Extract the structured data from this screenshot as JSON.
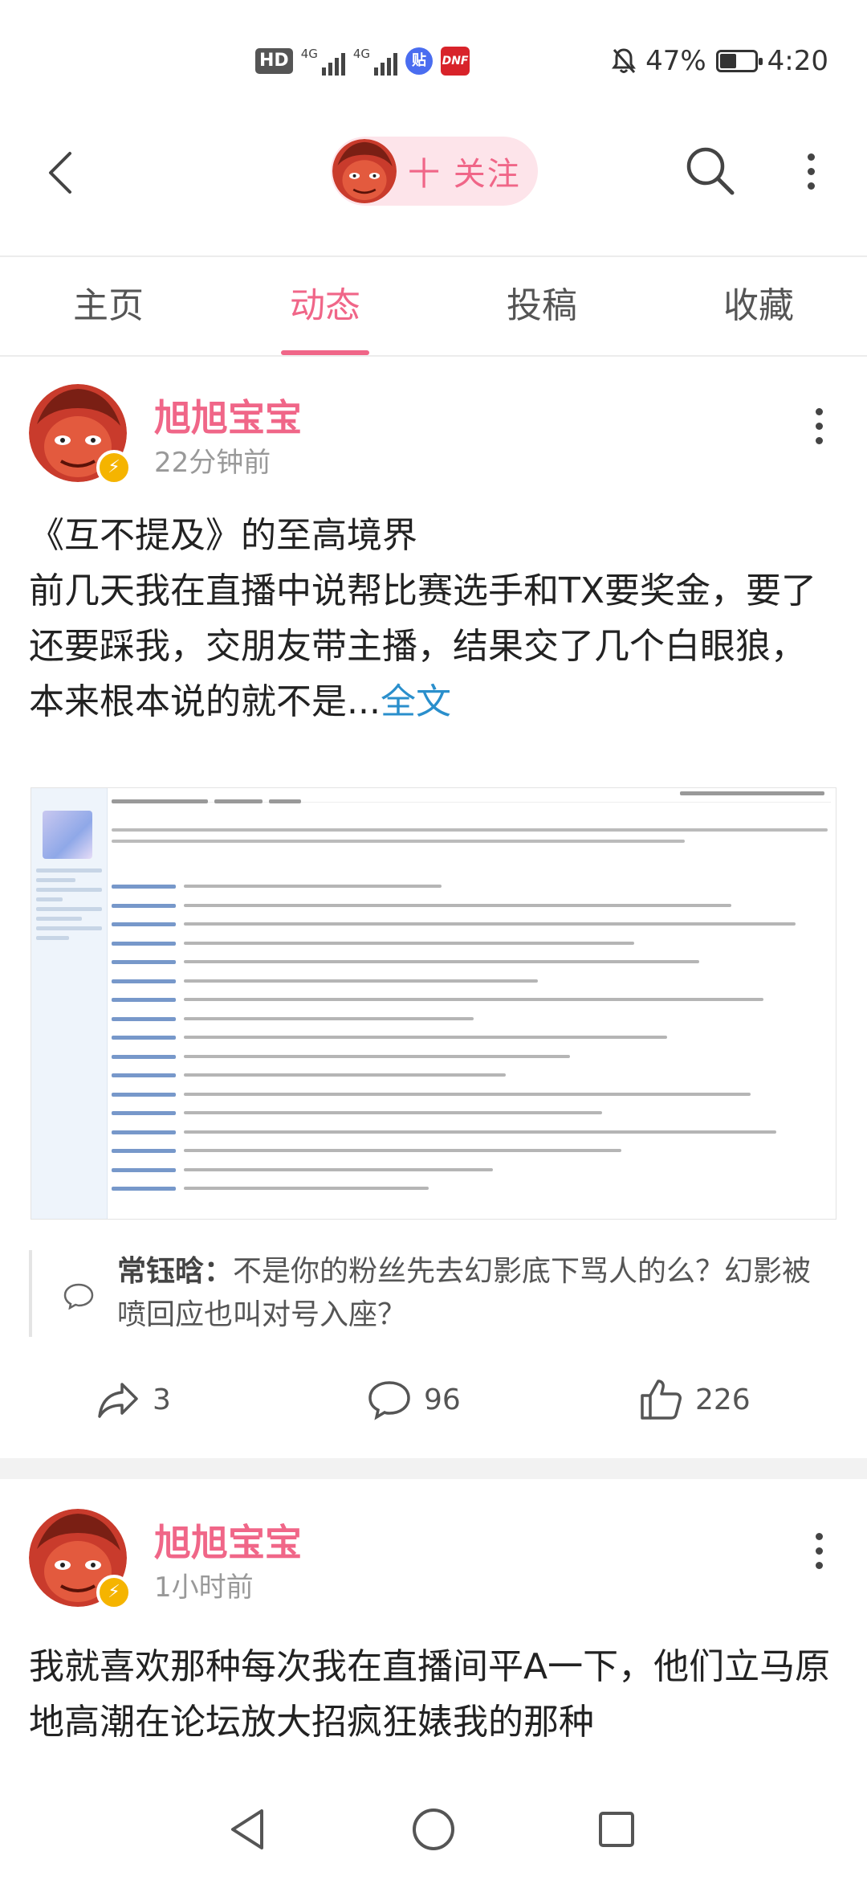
{
  "status_bar": {
    "hd_label": "HD",
    "net1": "4G",
    "net2": "4G",
    "app1_label": "贴",
    "app2_label": "DNF",
    "battery": "47%",
    "battery_fraction": 0.47,
    "time": "4:20"
  },
  "header": {
    "follow_label": "十 关注"
  },
  "tabs": [
    {
      "label": "主页"
    },
    {
      "label": "动态",
      "active": true
    },
    {
      "label": "投稿"
    },
    {
      "label": "收藏"
    }
  ],
  "posts": [
    {
      "author": "旭旭宝宝",
      "time": "22分钟前",
      "text_line1": "《互不提及》的至高境界",
      "text_body": "前几天我在直播中说帮比赛选手和TX要奖金，要了还要踩我，交朋友带主播，结果交了几个白眼狼，本来根本说的就不是...",
      "full_text_link": "全文",
      "comment_author": "常钰晗：",
      "comment_text": "不是你的粉丝先去幻影底下骂人的么？幻影被喷回应也叫对号入座？",
      "shares": "3",
      "comments": "96",
      "likes": "226"
    },
    {
      "author": "旭旭宝宝",
      "time": "1小时前",
      "text_body": "我就喜欢那种每次我在直播间平A一下，他们立马原地高潮在论坛放大招疯狂婊我的那种"
    }
  ],
  "colors": {
    "accent": "#f06688",
    "link": "#2a8fcc",
    "badge": "#f5b400"
  }
}
